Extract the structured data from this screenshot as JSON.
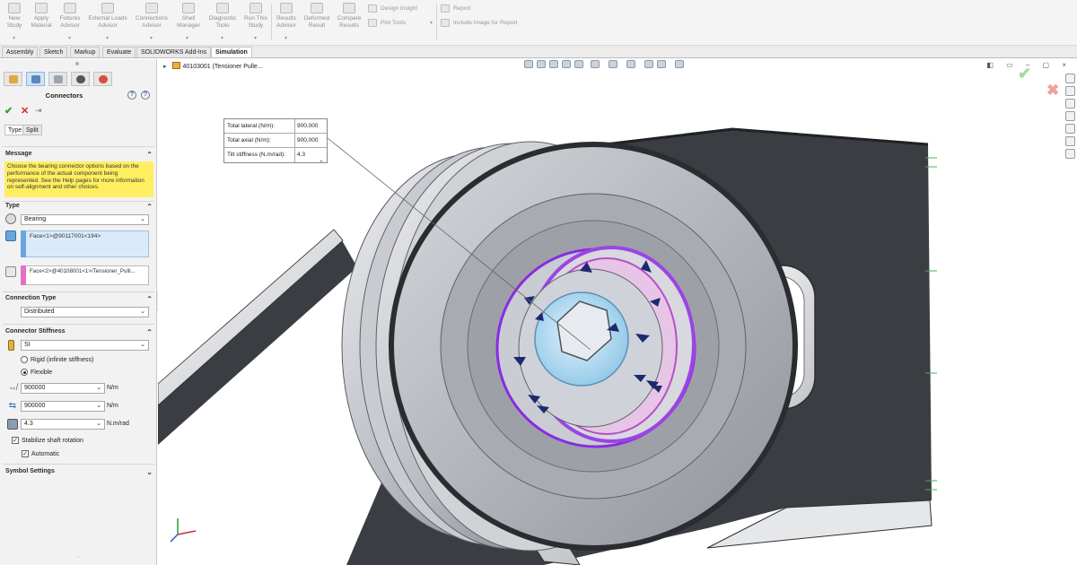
{
  "ribbon": {
    "buttons": [
      {
        "label": "New\nStudy"
      },
      {
        "label": "Apply\nMaterial"
      },
      {
        "label": "Fixtures\nAdvisor"
      },
      {
        "label": "External Loads\nAdvisor"
      },
      {
        "label": "Connections\nAdvisor"
      },
      {
        "label": "Shell\nManager"
      },
      {
        "label": "Diagnostic\nTools"
      },
      {
        "label": "Run This\nStudy"
      },
      {
        "label": "Results\nAdvisor"
      },
      {
        "label": "Deformed\nResult"
      },
      {
        "label": "Compare\nResults"
      }
    ],
    "small": {
      "design_insight": "Design Insight",
      "plot_tools": "Plot Tools",
      "report": "Report",
      "include_image": "Include Image for Report"
    }
  },
  "tabs": [
    "Assembly",
    "Sketch",
    "Markup",
    "Evaluate",
    "SOLIDWORKS Add-Ins",
    "Simulation"
  ],
  "active_tab": "Simulation",
  "property_manager": {
    "title": "Connectors",
    "subtabs": [
      "Type",
      "Split"
    ],
    "message": {
      "header": "Message",
      "text": "Choose the bearing connector options based on the performance of the actual component being represented. See the Help pages for more information on self-alignment and other choices."
    },
    "type": {
      "header": "Type",
      "selected": "Bearing",
      "face1": "Face<1>@90117001<194>",
      "face2": "Face<2>@40108001<1>/Tensioner_Pulli..."
    },
    "connection_type": {
      "header": "Connection Type",
      "selected": "Distributed"
    },
    "connector_stiffness": {
      "header": "Connector Stiffness",
      "unit_system": "SI",
      "rigid_label": "Rigid (infinite stiffness)",
      "flexible_label": "Flexible",
      "lateral_value": "900000",
      "lateral_unit": "N/m",
      "axial_value": "900000",
      "axial_unit": "N/m",
      "tilt_value": "4.3",
      "tilt_unit": "N.m/rad",
      "stabilize_label": "Stabilize shaft rotation",
      "automatic_label": "Automatic"
    },
    "symbol_settings": {
      "header": "Symbol Settings"
    }
  },
  "graphics": {
    "tree_item": "40103001 (Tensioner Pulle...",
    "callout": {
      "rows": [
        {
          "key": "Total lateral (N/m):",
          "value": "900,000"
        },
        {
          "key": "Total axial (N/m):",
          "value": "900,000"
        },
        {
          "key": "Tilt stiffness (N.m/rad):",
          "value": "4.3"
        }
      ]
    }
  },
  "colors": {
    "message_bg": "#ffef60",
    "ok_green": "#29a33a",
    "cancel_red": "#d02b2b",
    "bearing_purple": "#8a2be2",
    "arrow_navy": "#1b2a6e",
    "bracket_dark": "#3a3d42",
    "shaft_blue": "#8fc7e8"
  }
}
